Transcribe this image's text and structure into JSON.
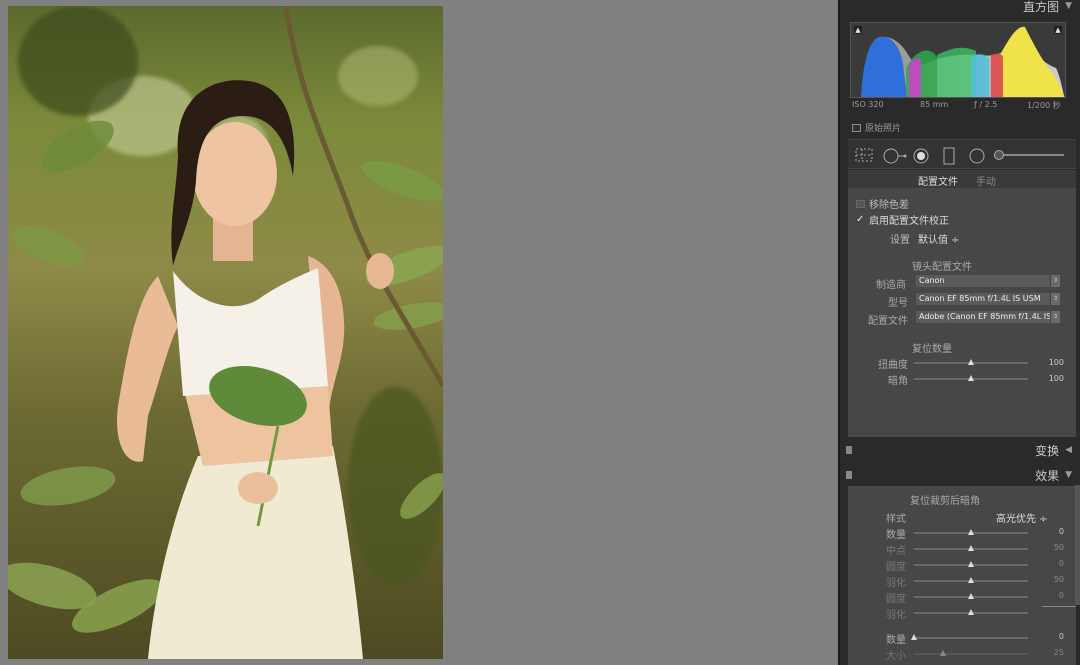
{
  "histogram": {
    "title": "直方图",
    "iso": "ISO 320",
    "focal": "85 mm",
    "aperture": "ƒ / 2.5",
    "shutter": "1/200 秒",
    "original_photo_label": "原始照片"
  },
  "lens_panel": {
    "tab_profile": "配置文件",
    "tab_manual": "手动",
    "remove_ca": "移除色差",
    "enable_profile": "启用配置文件校正",
    "setup_label": "设置",
    "setup_value": "默认值 ÷",
    "lens_profile_header": "镜头配置文件",
    "make_label": "制造商",
    "make_value": "Canon",
    "model_label": "型号",
    "model_value": "Canon EF 85mm f/1.4L IS USM",
    "profile_label": "配置文件",
    "profile_value": "Adobe (Canon EF 85mm f/1.4L IS...",
    "amount_header": "复位数量",
    "distortion_label": "扭曲度",
    "distortion_value": "100",
    "distortion_fraction": 0.5,
    "vignetting_label": "暗角",
    "vignetting_value": "100",
    "vignetting_fraction": 0.5
  },
  "transform": {
    "title": "变换"
  },
  "effects": {
    "title": "效果",
    "section_title": "复位裁剪后暗角",
    "style_label": "样式",
    "style_value": "高光优先 ÷",
    "sliders": [
      {
        "label": "数量",
        "value": "0",
        "fraction": 0.5
      },
      {
        "label": "中点",
        "value": "50",
        "fraction": 0.5
      },
      {
        "label": "圆度",
        "value": "0",
        "fraction": 0.5
      },
      {
        "label": "羽化",
        "value": "50",
        "fraction": 0.5
      },
      {
        "label": "圆度",
        "value": "0",
        "fraction": 0.5
      },
      {
        "label": "羽化",
        "value": "",
        "fraction": 0.5
      }
    ],
    "grain_amount_label": "数量",
    "grain_amount_value": "0",
    "grain_amount_fraction": 0.0,
    "grain_size_label": "大小",
    "grain_size_value": "25",
    "grain_size_fraction": 0.25
  }
}
